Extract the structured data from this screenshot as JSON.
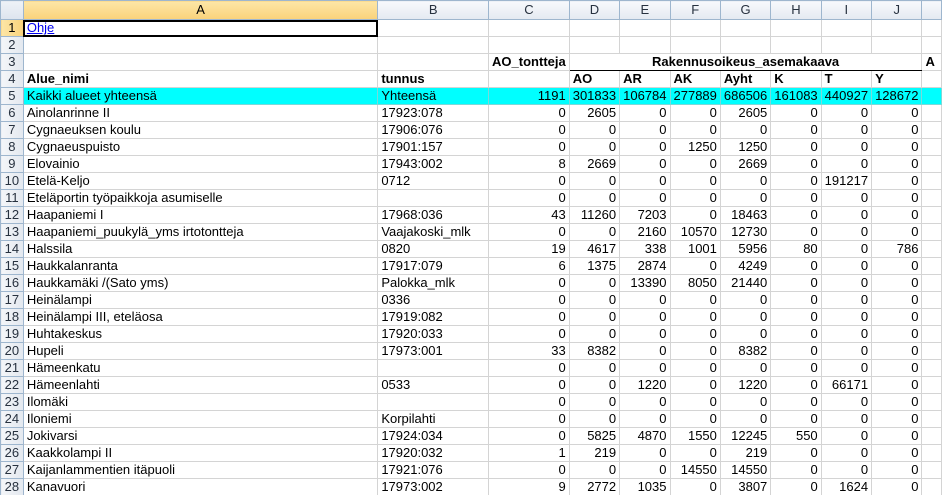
{
  "columns": [
    "A",
    "B",
    "C",
    "D",
    "E",
    "F",
    "G",
    "H",
    "I",
    "J"
  ],
  "selected_column": "A",
  "selected_row": "1",
  "cells": {
    "a1": "Ohje",
    "c3": "AO_tontteja",
    "d3": "Rakennusoikeus_asemakaava",
    "k3": "A"
  },
  "header": {
    "rownum": "4",
    "a": "Alue_nimi",
    "b": "tunnus",
    "d": "AO",
    "e": "AR",
    "f": "AK",
    "g": "Ayht",
    "h": "K",
    "i": "T",
    "j": "Y"
  },
  "rows": [
    {
      "n": "5",
      "a": "Kaikki alueet yhteensä",
      "b": "Yhteensä",
      "c": "1191",
      "d": "301833",
      "e": "106784",
      "f": "277889",
      "g": "686506",
      "h": "161083",
      "i": "440927",
      "j": "128672"
    },
    {
      "n": "6",
      "a": "Ainolanrinne II",
      "b": "17923:078",
      "c": "0",
      "d": "2605",
      "e": "0",
      "f": "0",
      "g": "2605",
      "h": "0",
      "i": "0",
      "j": "0"
    },
    {
      "n": "7",
      "a": "Cygnaeuksen koulu",
      "b": "17906:076",
      "c": "0",
      "d": "0",
      "e": "0",
      "f": "0",
      "g": "0",
      "h": "0",
      "i": "0",
      "j": "0"
    },
    {
      "n": "8",
      "a": "Cygnaeuspuisto",
      "b": "17901:157",
      "c": "0",
      "d": "0",
      "e": "0",
      "f": "1250",
      "g": "1250",
      "h": "0",
      "i": "0",
      "j": "0"
    },
    {
      "n": "9",
      "a": "Elovainio",
      "b": "17943:002",
      "c": "8",
      "d": "2669",
      "e": "0",
      "f": "0",
      "g": "2669",
      "h": "0",
      "i": "0",
      "j": "0"
    },
    {
      "n": "10",
      "a": "Etelä-Keljo",
      "b": "0712",
      "c": "0",
      "d": "0",
      "e": "0",
      "f": "0",
      "g": "0",
      "h": "0",
      "i": "191217",
      "j": "0"
    },
    {
      "n": "11",
      "a": "Eteläportin työpaikkoja asumiselle",
      "b": "",
      "c": "0",
      "d": "0",
      "e": "0",
      "f": "0",
      "g": "0",
      "h": "0",
      "i": "0",
      "j": "0"
    },
    {
      "n": "12",
      "a": "Haapaniemi I",
      "b": "17968:036",
      "c": "43",
      "d": "11260",
      "e": "7203",
      "f": "0",
      "g": "18463",
      "h": "0",
      "i": "0",
      "j": "0"
    },
    {
      "n": "13",
      "a": "Haapaniemi_puukylä_yms irtotontteja",
      "b": "Vaajakoski_mlk",
      "c": "0",
      "d": "0",
      "e": "2160",
      "f": "10570",
      "g": "12730",
      "h": "0",
      "i": "0",
      "j": "0"
    },
    {
      "n": "14",
      "a": "Halssila",
      "b": "0820",
      "c": "19",
      "d": "4617",
      "e": "338",
      "f": "1001",
      "g": "5956",
      "h": "80",
      "i": "0",
      "j": "786"
    },
    {
      "n": "15",
      "a": "Haukkalanranta",
      "b": "17917:079",
      "c": "6",
      "d": "1375",
      "e": "2874",
      "f": "0",
      "g": "4249",
      "h": "0",
      "i": "0",
      "j": "0"
    },
    {
      "n": "16",
      "a": "Haukkamäki /(Sato yms)",
      "b": "Palokka_mlk",
      "c": "0",
      "d": "0",
      "e": "13390",
      "f": "8050",
      "g": "21440",
      "h": "0",
      "i": "0",
      "j": "0"
    },
    {
      "n": "17",
      "a": "Heinälampi",
      "b": "0336",
      "c": "0",
      "d": "0",
      "e": "0",
      "f": "0",
      "g": "0",
      "h": "0",
      "i": "0",
      "j": "0"
    },
    {
      "n": "18",
      "a": "Heinälampi III, eteläosa",
      "b": "17919:082",
      "c": "0",
      "d": "0",
      "e": "0",
      "f": "0",
      "g": "0",
      "h": "0",
      "i": "0",
      "j": "0"
    },
    {
      "n": "19",
      "a": "Huhtakeskus",
      "b": "17920:033",
      "c": "0",
      "d": "0",
      "e": "0",
      "f": "0",
      "g": "0",
      "h": "0",
      "i": "0",
      "j": "0"
    },
    {
      "n": "20",
      "a": "Hupeli",
      "b": "17973:001",
      "c": "33",
      "d": "8382",
      "e": "0",
      "f": "0",
      "g": "8382",
      "h": "0",
      "i": "0",
      "j": "0"
    },
    {
      "n": "21",
      "a": "Hämeenkatu",
      "b": "",
      "c": "0",
      "d": "0",
      "e": "0",
      "f": "0",
      "g": "0",
      "h": "0",
      "i": "0",
      "j": "0"
    },
    {
      "n": "22",
      "a": "Hämeenlahti",
      "b": "0533",
      "c": "0",
      "d": "0",
      "e": "1220",
      "f": "0",
      "g": "1220",
      "h": "0",
      "i": "66171",
      "j": "0"
    },
    {
      "n": "23",
      "a": "Ilomäki",
      "b": "",
      "c": "0",
      "d": "0",
      "e": "0",
      "f": "0",
      "g": "0",
      "h": "0",
      "i": "0",
      "j": "0"
    },
    {
      "n": "24",
      "a": "Iloniemi",
      "b": "Korpilahti",
      "c": "0",
      "d": "0",
      "e": "0",
      "f": "0",
      "g": "0",
      "h": "0",
      "i": "0",
      "j": "0"
    },
    {
      "n": "25",
      "a": "Jokivarsi",
      "b": "17924:034",
      "c": "0",
      "d": "5825",
      "e": "4870",
      "f": "1550",
      "g": "12245",
      "h": "550",
      "i": "0",
      "j": "0"
    },
    {
      "n": "26",
      "a": "Kaakkolampi II",
      "b": "17920:032",
      "c": "1",
      "d": "219",
      "e": "0",
      "f": "0",
      "g": "219",
      "h": "0",
      "i": "0",
      "j": "0"
    },
    {
      "n": "27",
      "a": "Kaijanlammentien itäpuoli",
      "b": "17921:076",
      "c": "0",
      "d": "0",
      "e": "0",
      "f": "14550",
      "g": "14550",
      "h": "0",
      "i": "0",
      "j": "0"
    },
    {
      "n": "28",
      "a": "Kanavuori",
      "b": "17973:002",
      "c": "9",
      "d": "2772",
      "e": "1035",
      "f": "0",
      "g": "3807",
      "h": "0",
      "i": "1624",
      "j": "0"
    }
  ]
}
